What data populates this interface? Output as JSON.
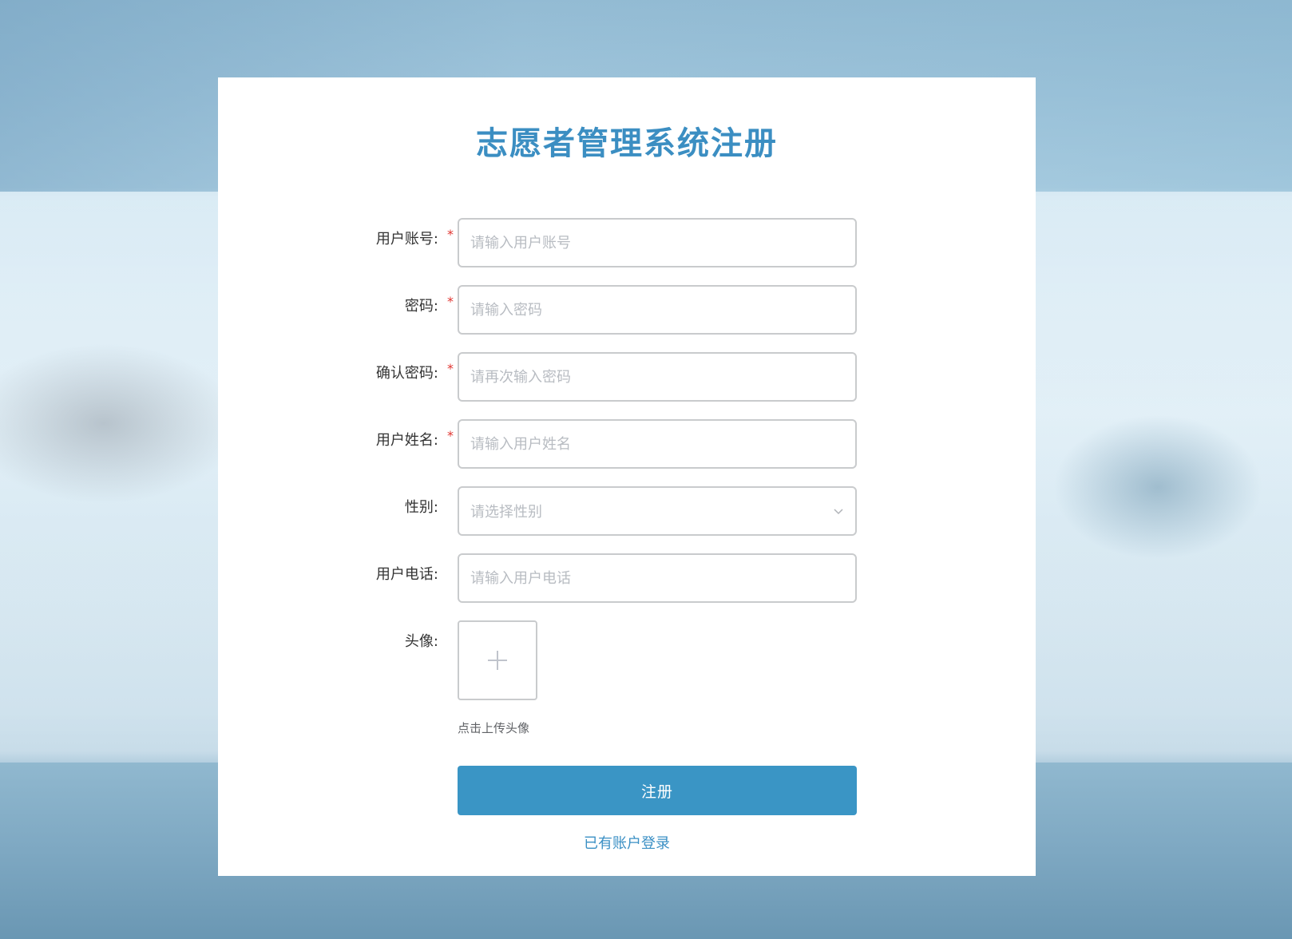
{
  "form": {
    "title": "志愿者管理系统注册",
    "fields": [
      {
        "label": "用户账号:",
        "required": true,
        "placeholder": "请输入用户账号",
        "value": ""
      },
      {
        "label": "密码:",
        "required": true,
        "placeholder": "请输入密码",
        "value": ""
      },
      {
        "label": "确认密码:",
        "required": true,
        "placeholder": "请再次输入密码",
        "value": ""
      },
      {
        "label": "用户姓名:",
        "required": true,
        "placeholder": "请输入用户姓名",
        "value": ""
      }
    ],
    "gender": {
      "label": "性别:",
      "placeholder": "请选择性别"
    },
    "phone": {
      "label": "用户电话:",
      "placeholder": "请输入用户电话",
      "value": ""
    },
    "avatar": {
      "label": "头像:",
      "tip": "点击上传头像"
    },
    "required_mark": "*",
    "submit_label": "注册",
    "login_link": "已有账户登录"
  },
  "icons": {
    "select_arrow": "chevron-down-icon",
    "upload": "plus-icon"
  },
  "colors": {
    "accent": "#3a95c5",
    "title": "#3b8ec2",
    "required": "#e0342f"
  }
}
